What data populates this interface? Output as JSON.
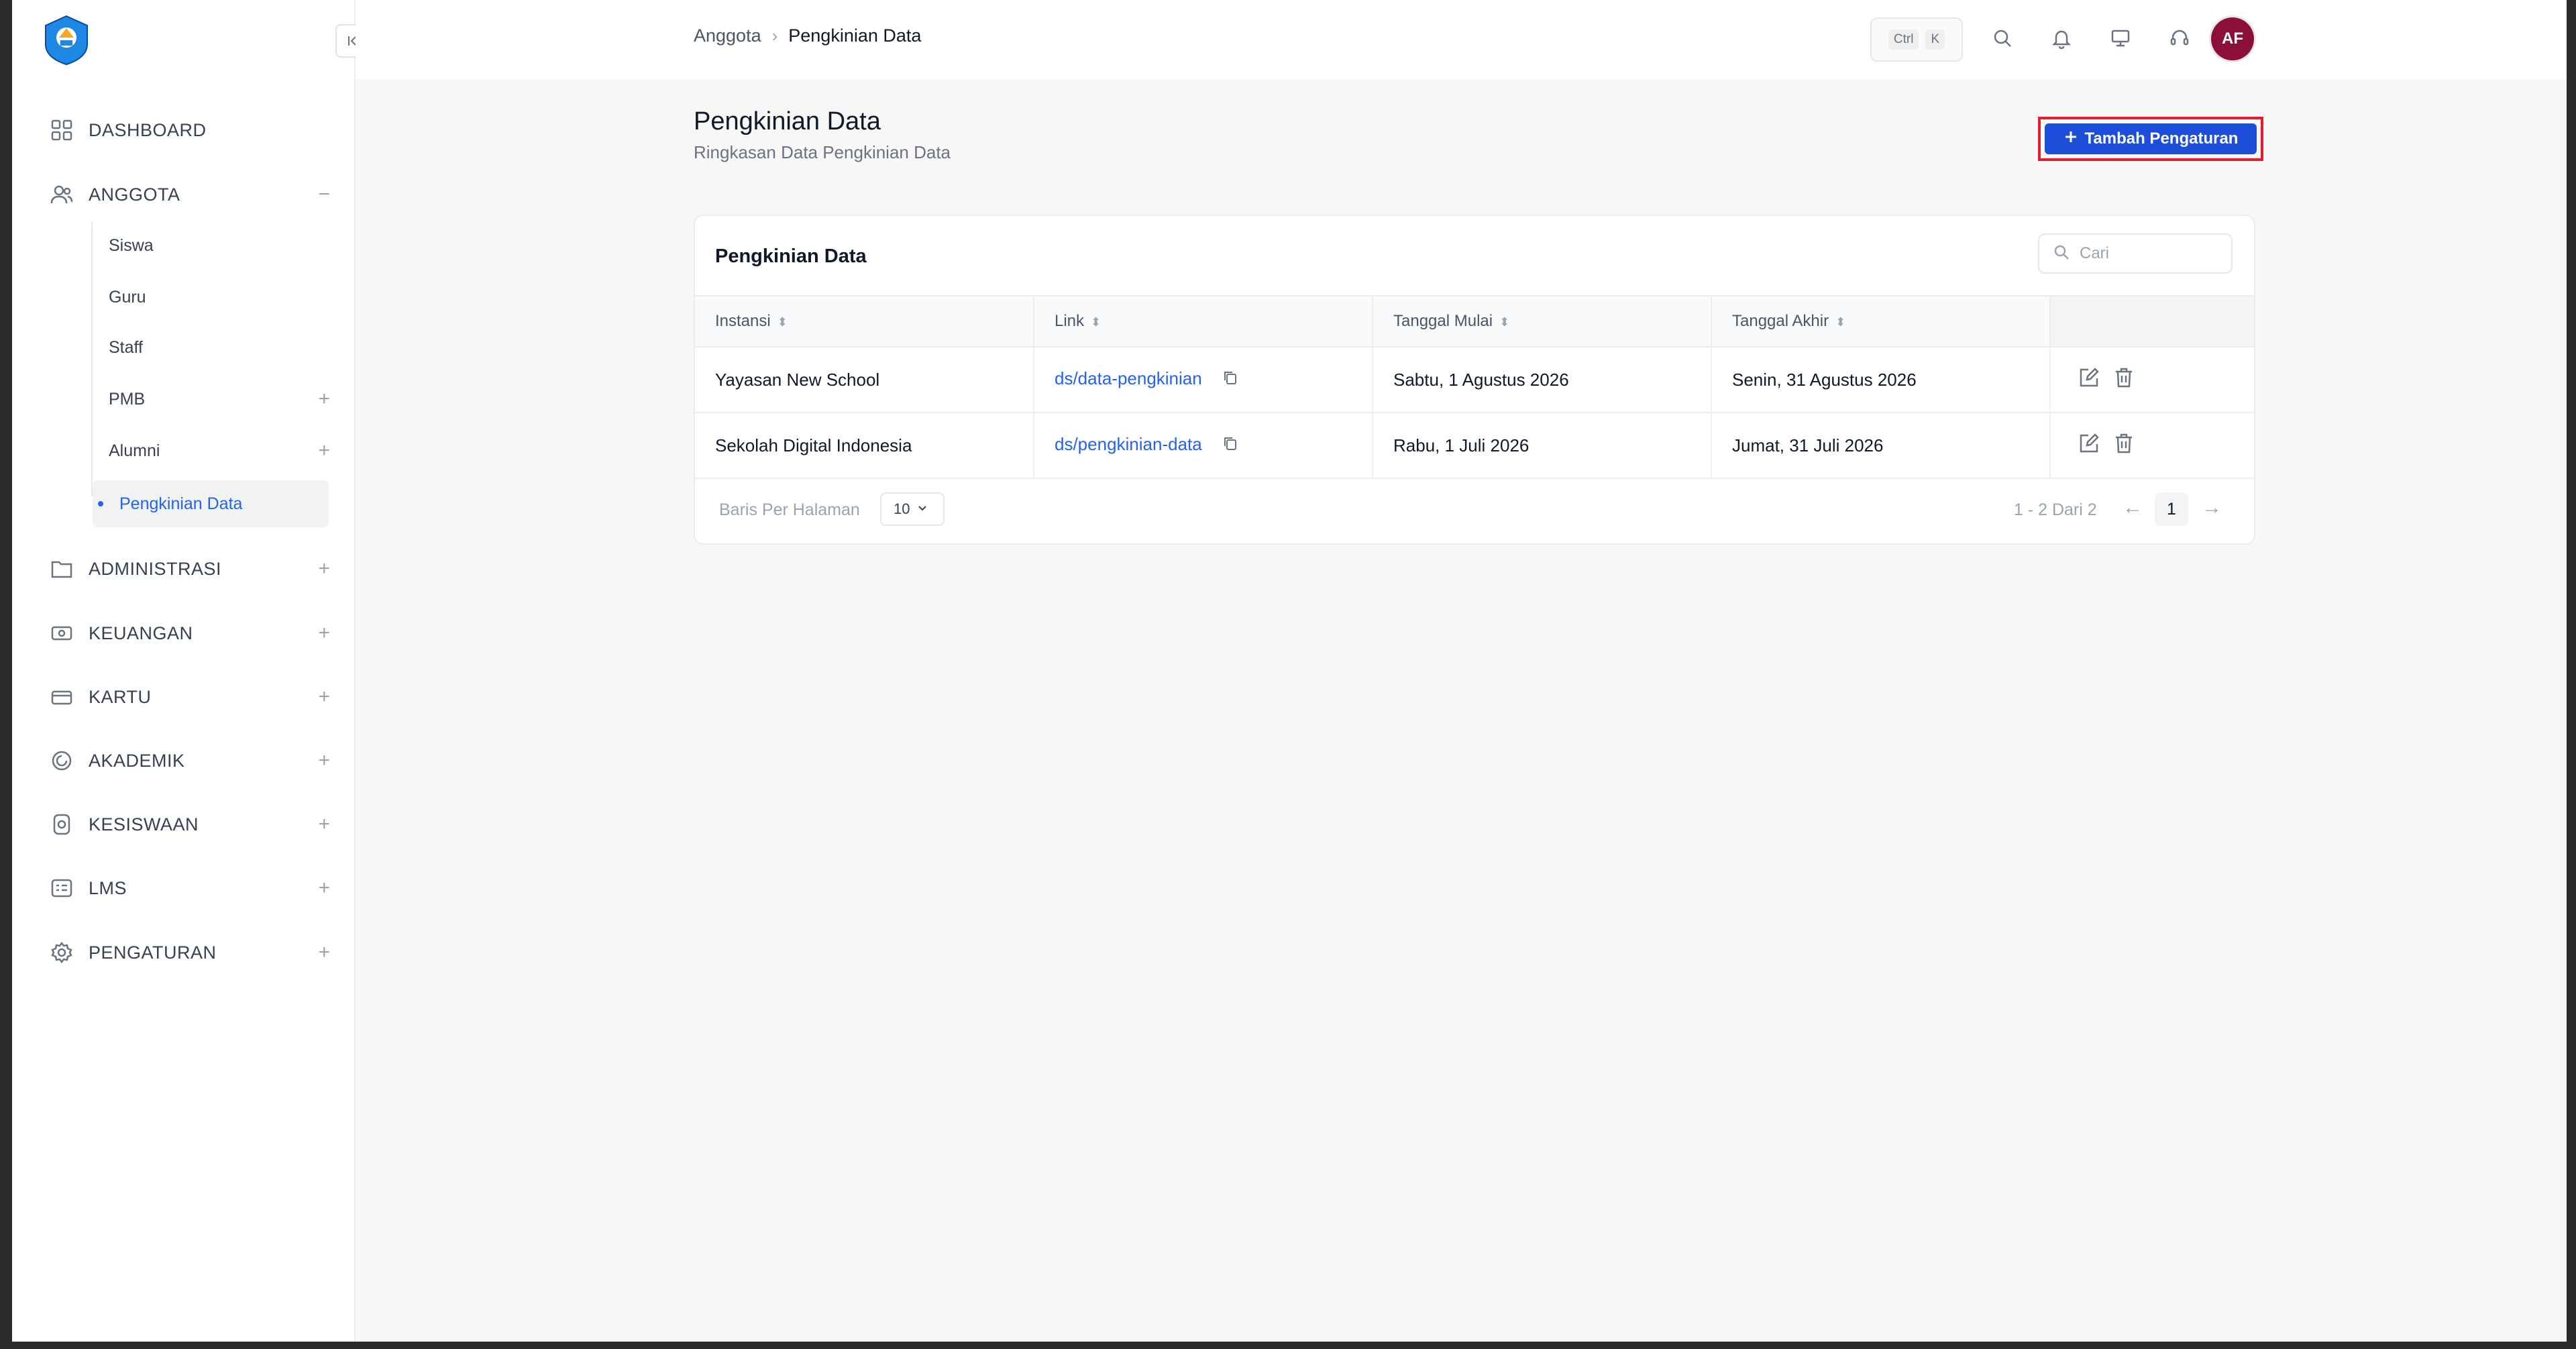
{
  "sidebar": {
    "collapse_icon": "collapse-left-icon",
    "items": [
      {
        "label": "DASHBOARD",
        "icon": "dashboard-grid-icon"
      },
      {
        "label": "ANGGOTA",
        "icon": "users-icon",
        "toggle": "−"
      },
      {
        "label": "ADMINISTRASI",
        "icon": "folder-icon",
        "toggle": "+"
      },
      {
        "label": "KEUANGAN",
        "icon": "money-icon",
        "toggle": "+"
      },
      {
        "label": "KARTU",
        "icon": "card-icon",
        "toggle": "+"
      },
      {
        "label": "AKADEMIK",
        "icon": "academic-icon",
        "toggle": "+"
      },
      {
        "label": "KESISWAAN",
        "icon": "student-icon",
        "toggle": "+"
      },
      {
        "label": "LMS",
        "icon": "lms-icon",
        "toggle": "+"
      },
      {
        "label": "PENGATURAN",
        "icon": "gear-icon",
        "toggle": "+"
      }
    ],
    "anggota_sub": [
      {
        "label": "Siswa"
      },
      {
        "label": "Guru"
      },
      {
        "label": "Staff"
      },
      {
        "label": "PMB",
        "toggle": "+"
      },
      {
        "label": "Alumni",
        "toggle": "+"
      },
      {
        "label": "Pengkinian Data",
        "active": true
      }
    ]
  },
  "header": {
    "breadcrumb": [
      "Anggota",
      "Pengkinian Data"
    ],
    "shortcut": [
      "Ctrl",
      "K"
    ]
  },
  "page": {
    "title": "Pengkinian Data",
    "subtitle": "Ringkasan Data Pengkinian Data",
    "add_button": "Tambah Pengaturan"
  },
  "card": {
    "title": "Pengkinian Data",
    "search_placeholder": "Cari",
    "columns": [
      "Instansi",
      "Link",
      "Tanggal Mulai",
      "Tanggal Akhir"
    ],
    "rows": [
      {
        "instansi": "Yayasan New School",
        "link": "ds/data-pengkinian",
        "mulai": "Sabtu, 1 Agustus 2026",
        "akhir": "Senin, 31 Agustus 2026"
      },
      {
        "instansi": "Sekolah Digital Indonesia",
        "link": "ds/pengkinian-data",
        "mulai": "Rabu, 1 Juli 2026",
        "akhir": "Jumat, 31 Juli 2026"
      }
    ],
    "footer": {
      "rows_label": "Baris Per Halaman",
      "rows_value": "10",
      "page_info": "1 - 2 Dari 2",
      "current_page": "1"
    }
  },
  "colors": {
    "accent": "#2563eb",
    "button": "#1d4ed8",
    "highlight": "#e11d2e",
    "avatar": "#8b0f3a"
  },
  "user": {
    "initials": "AF"
  }
}
